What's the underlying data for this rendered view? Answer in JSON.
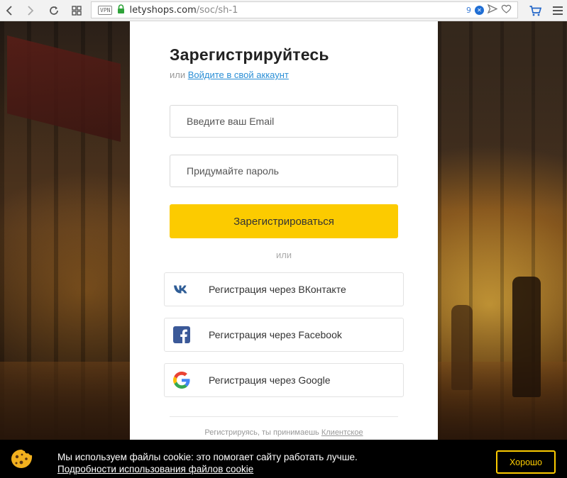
{
  "browser": {
    "vpn_label": "VPN",
    "url_host": "letyshops.com",
    "url_path": "/soc/sh-1",
    "extension_count": "9",
    "icons": [
      "back-icon",
      "forward-icon",
      "reload-icon",
      "grid-icon",
      "lock-icon",
      "send-icon",
      "heart-icon",
      "cart-icon",
      "menu-icon"
    ]
  },
  "panel": {
    "title": "Зарегистрируйтесь",
    "subtitle_prefix": "или",
    "login_link": "Войдите в свой аккаунт",
    "email_placeholder": "Введите ваш Email",
    "password_placeholder": "Придумайте пароль",
    "register_button": "Зарегистрироваться",
    "or_label": "или",
    "social": [
      {
        "label": "Регистрация через ВКонтакте",
        "icon": "vk-icon"
      },
      {
        "label": "Регистрация через Facebook",
        "icon": "facebook-icon"
      },
      {
        "label": "Регистрация через Google",
        "icon": "google-icon"
      }
    ],
    "terms_prefix": "Регистрируясь, ты принимаешь",
    "terms_link": "Клиентское"
  },
  "cookie": {
    "line1": "Мы используем файлы cookie: это помогает сайту работать лучше.",
    "details_link": "Подробности использования файлов cookie",
    "ok_button": "Хорошо"
  },
  "colors": {
    "accent": "#fccb00",
    "link": "#2b8fd6",
    "vk": "#4a76a8",
    "facebook": "#3b5998"
  }
}
